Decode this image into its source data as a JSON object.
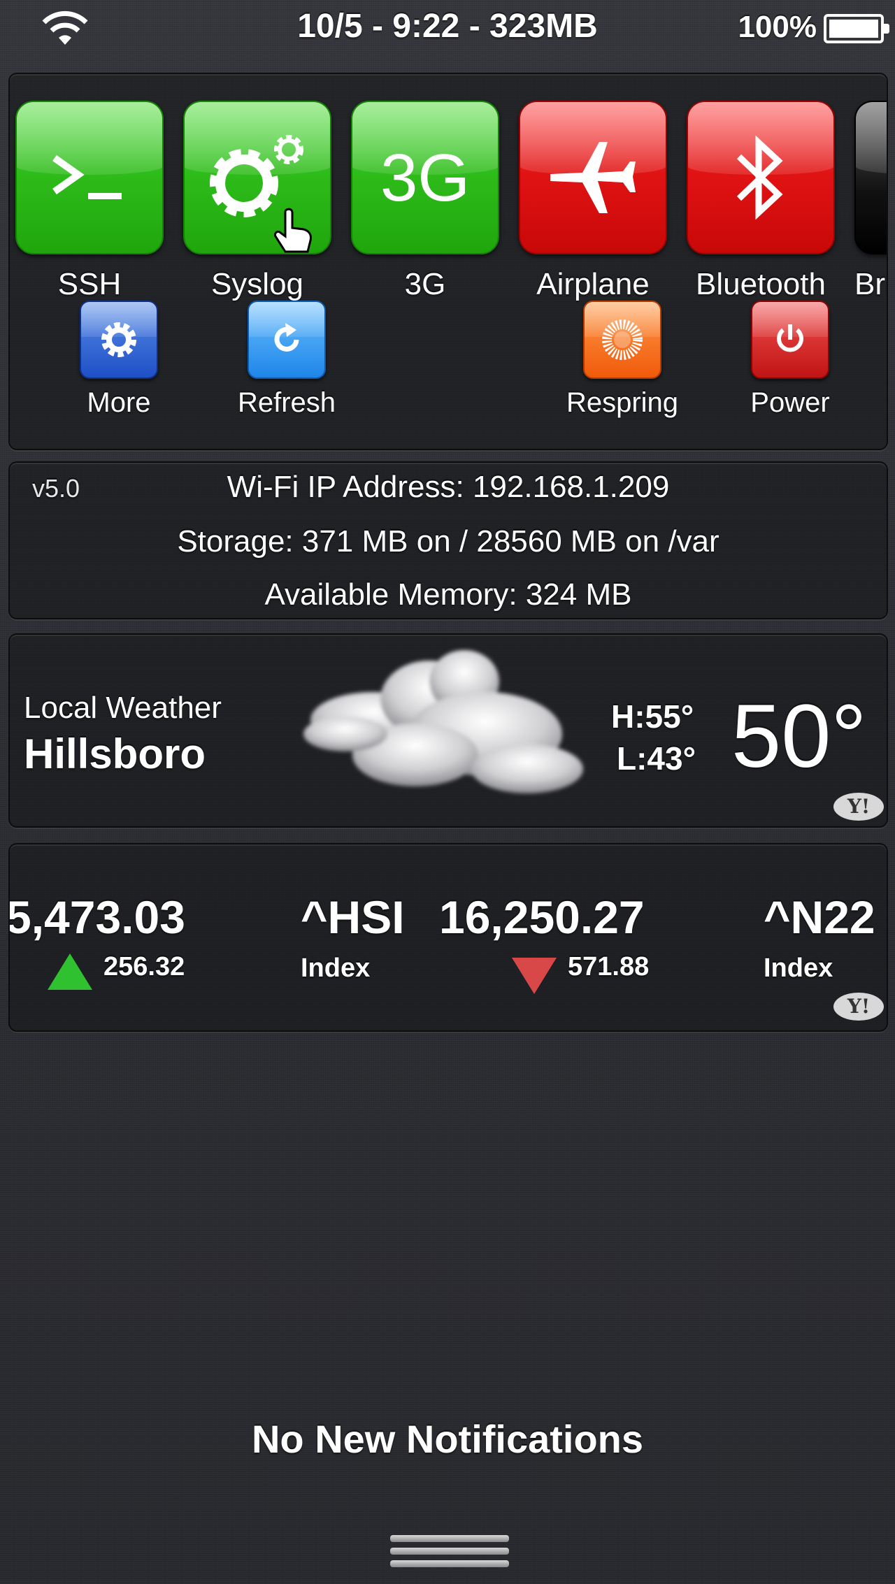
{
  "status_bar": {
    "center_text": "10/5 - 9:22 - 323MB",
    "battery_percent": "100%",
    "battery_level": 1.0
  },
  "toggles": [
    {
      "label": "SSH",
      "color": "green",
      "icon": "terminal-icon",
      "glyph": ">_"
    },
    {
      "label": "Syslog",
      "color": "green",
      "icon": "gears-icon"
    },
    {
      "label": "3G",
      "color": "green",
      "icon": "3g-icon",
      "glyph": "3G"
    },
    {
      "label": "Airplane",
      "color": "red",
      "icon": "airplane-icon"
    },
    {
      "label": "Bluetooth",
      "color": "red",
      "icon": "bluetooth-icon"
    },
    {
      "label": "Bri",
      "color": "dark",
      "icon": "brightness-icon"
    }
  ],
  "small_buttons": [
    {
      "label": "More",
      "icon": "gear-icon",
      "color": "#1e4fc6"
    },
    {
      "label": "Refresh",
      "icon": "refresh-icon",
      "color": "#1e86e8"
    },
    {
      "label": "Respring",
      "icon": "sunburst-icon",
      "color": "#f05a0a"
    },
    {
      "label": "Power",
      "icon": "power-icon",
      "color": "#c11414"
    }
  ],
  "info": {
    "version": "v5.0",
    "wifi_ip": "Wi-Fi IP Address: 192.168.1.209",
    "storage": "Storage: 371 MB on / 28560 MB on /var",
    "memory": "Available Memory: 324 MB"
  },
  "weather": {
    "title": "Local Weather",
    "city": "Hillsboro",
    "high": "H:55°",
    "low": "L:43°",
    "temp": "50°",
    "icon": "cloud-icon",
    "provider_badge": "Y!"
  },
  "stocks": {
    "items": [
      {
        "value": "5,473.03",
        "change": "256.32",
        "direction": "up"
      },
      {
        "symbol": "^HSI",
        "type": "Index",
        "value": "16,250.27",
        "change": "571.88",
        "direction": "down"
      },
      {
        "symbol": "^N22",
        "type": "Index"
      }
    ],
    "provider_badge": "Y!"
  },
  "notifications": {
    "empty_text": "No New Notifications"
  },
  "colors": {
    "toggle_green": "#2fbd1b",
    "toggle_red": "#e21414",
    "stock_up": "#2fc12f",
    "stock_down": "#d84848"
  }
}
